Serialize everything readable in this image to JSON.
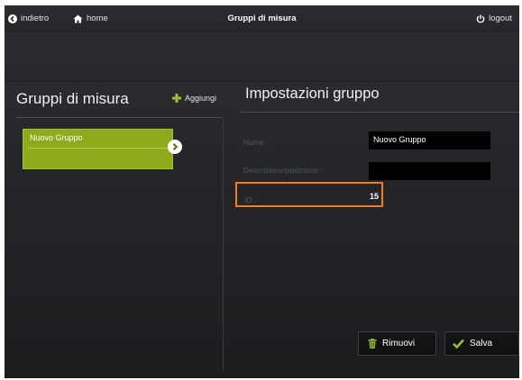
{
  "topbar": {
    "back_label": "indietro",
    "home_label": "home",
    "title": "Gruppi di misura",
    "logout_label": "logout"
  },
  "left_panel": {
    "heading": "Gruppi di misura",
    "add_label": "Aggiungi",
    "groups": [
      {
        "name": "Nuovo Gruppo"
      }
    ]
  },
  "right_panel": {
    "heading": "Impostazioni gruppo",
    "fields": {
      "name_label": "Nome :",
      "name_value": "Nuovo Gruppo",
      "description_label": "Descrizione/posizione :",
      "description_value": "",
      "id_label": "ID:",
      "id_value": "15"
    },
    "remove_label": "Rimuovi",
    "save_label": "Salva"
  },
  "colors": {
    "accent_green": "#8faa1b",
    "highlight_orange": "#f07c1f",
    "save_check": "#9bc22a"
  },
  "icons": [
    "back-icon",
    "home-icon",
    "logout-icon",
    "add-icon",
    "chevron-right-icon",
    "trash-icon",
    "check-icon"
  ]
}
